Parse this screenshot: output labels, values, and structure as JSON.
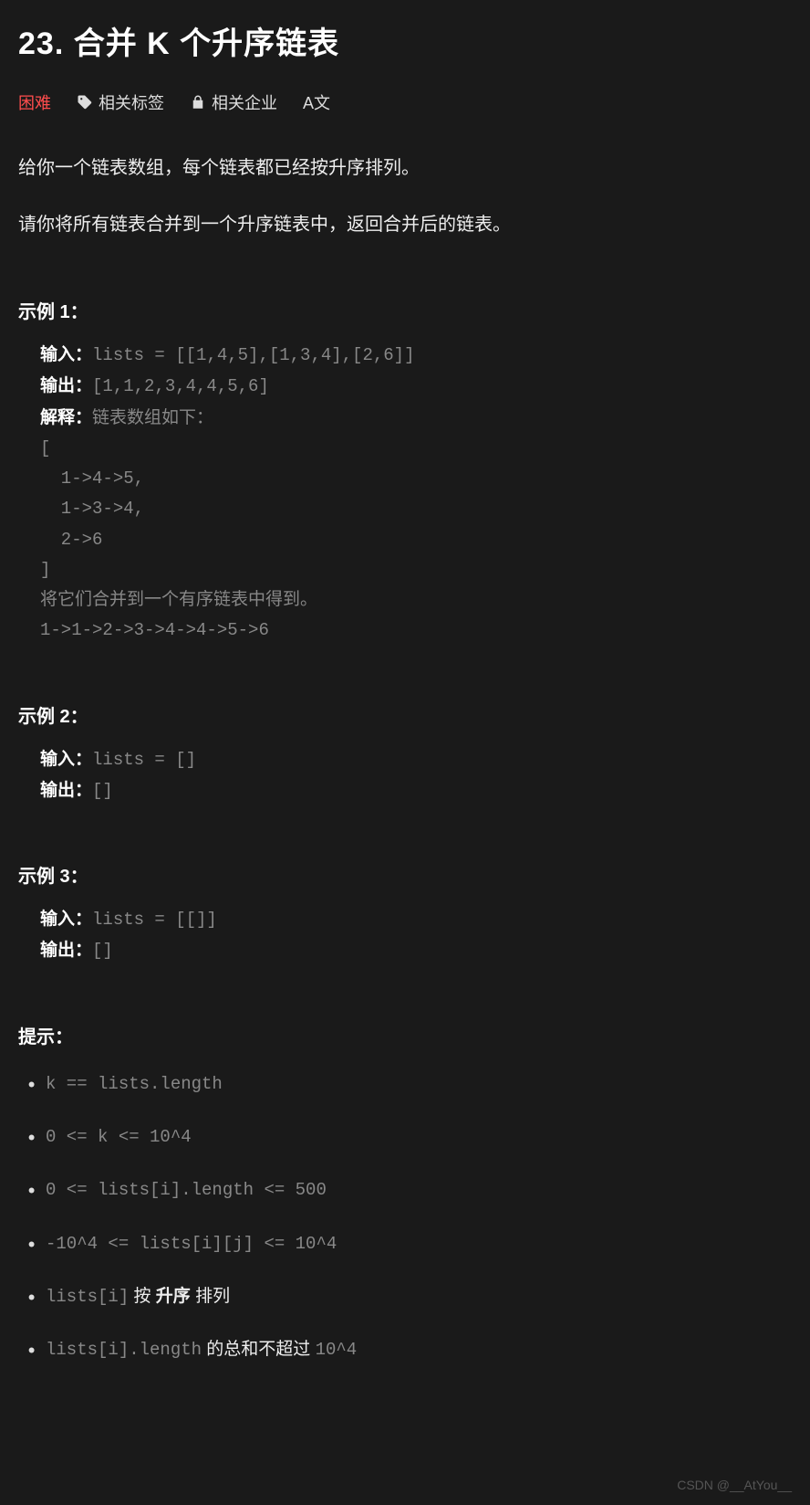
{
  "title": "23. 合并 K 个升序链表",
  "meta": {
    "difficulty": "困难",
    "tags_label": "相关标签",
    "company_label": "相关企业",
    "lang_label": "A文"
  },
  "description": {
    "p1": "给你一个链表数组，每个链表都已经按升序排列。",
    "p2": "请你将所有链表合并到一个升序链表中，返回合并后的链表。"
  },
  "example_labels": {
    "ex1": "示例 1：",
    "ex2": "示例 2：",
    "ex3": "示例 3：",
    "input": "输入：",
    "output": "输出：",
    "explain": "解释："
  },
  "example1": {
    "input": "lists = [[1,4,5],[1,3,4],[2,6]]",
    "output": "[1,1,2,3,4,4,5,6]",
    "explain_intro": "链表数组如下：",
    "explain_body": "[\n  1->4->5,\n  1->3->4,\n  2->6\n]\n将它们合并到一个有序链表中得到。\n1->1->2->3->4->4->5->6"
  },
  "example2": {
    "input": "lists = []",
    "output": "[]"
  },
  "example3": {
    "input": "lists = [[]]",
    "output": "[]"
  },
  "hints_label": "提示：",
  "hints": {
    "h1": "k == lists.length",
    "h2": "0 <= k <= 10^4",
    "h3": "0 <= lists[i].length <= 500",
    "h4": "-10^4 <= lists[i][j] <= 10^4",
    "h5a": "lists[i]",
    "h5b": " 按 ",
    "h5c": "升序",
    "h5d": " 排列",
    "h6a": "lists[i].length",
    "h6b": " 的总和不超过 ",
    "h6c": "10^4"
  },
  "watermark": "CSDN @__AtYou__"
}
